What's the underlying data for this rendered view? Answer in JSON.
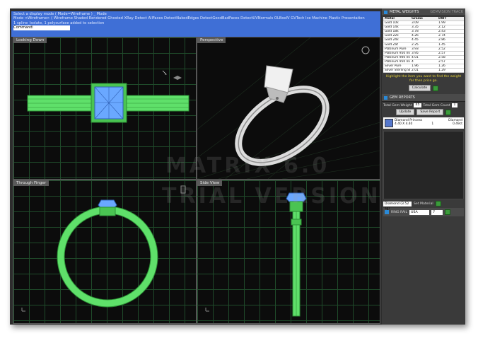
{
  "command_area": {
    "line1": "Select a display mode ( Mode=Wireframe ) _ Mode",
    "line2": "Mode <Wireframe> ( Wireframe Shaded Rendered Ghosted XRay Detect AllFaces DetectNakedEdges DetectGoodBadFaces DetectUVNormals OLBoxIV GVTech Ice Machine Plastic Presentation",
    "line3": "1 spline_Isolate, 1 polysurface added to selection",
    "line4": "Command:"
  },
  "viewports": {
    "top": {
      "title": "Looking Down"
    },
    "perspective": {
      "title": "Perspective"
    },
    "front": {
      "title": "Through Finger"
    },
    "side": {
      "title": "Side View"
    }
  },
  "watermark": {
    "line1": "MATRIX 6.0",
    "line2": "TRIAL VERSION"
  },
  "metal_weights": {
    "title": "METAL WEIGHTS",
    "tab2": "GEMVISION TRACK",
    "headers": [
      "Metal",
      "Grams",
      "DWT"
    ],
    "rows": [
      [
        "Gold 10k",
        "3.09",
        "1.99"
      ],
      [
        "Gold 14k",
        "3.35",
        "2.12"
      ],
      [
        "Gold 18k",
        "3.78",
        "2.43"
      ],
      [
        "Gold 22k",
        "4.26",
        "2.74"
      ],
      [
        "Gold 24k",
        "4.45",
        "2.86"
      ],
      [
        "Gold Zat",
        "2.25",
        "1.45"
      ],
      [
        "Platinum Pure",
        "3.93",
        "2.52"
      ],
      [
        "Platinum 950 Ind",
        "3.95",
        "2.57"
      ],
      [
        "Platinum 900 Ind",
        "4.01",
        "2.58"
      ],
      [
        "Platinum 950 Ind",
        "4",
        "2.57"
      ],
      [
        "Silver Pure",
        "1.96",
        "1.26"
      ],
      [
        "Silver Sterling St",
        "2.01",
        "1.29"
      ]
    ],
    "hint": "Highlight the item you want to find the weight for then price go.",
    "calculate_label": "Calculate"
  },
  "gem_reports": {
    "title": "GEM REPORTS",
    "total_weight_label": "Total Gem Weight",
    "total_weight_value": "45",
    "total_count_label": "Total Gem Count",
    "total_count_value": "1",
    "update_label": "Update",
    "save_label": "Save Report",
    "gem_name": "Diamond Princess",
    "gem_type": "Diamond",
    "gem_size": "4.40 X 4.40",
    "gem_count": "1",
    "gem_ct": "0.49ct",
    "material_select": "Diamond",
    "material_sg": "(3.52 sg)",
    "set_material_label": "Set Material"
  },
  "ring_rail": {
    "title": "RING RAIL",
    "region": "USA",
    "size": "7"
  },
  "colors": {
    "command_blue": "#3f6fd6",
    "ring_green": "#5fe06a",
    "gem_blue": "#6aa8ff",
    "grid_green": "#1f4a2a"
  }
}
